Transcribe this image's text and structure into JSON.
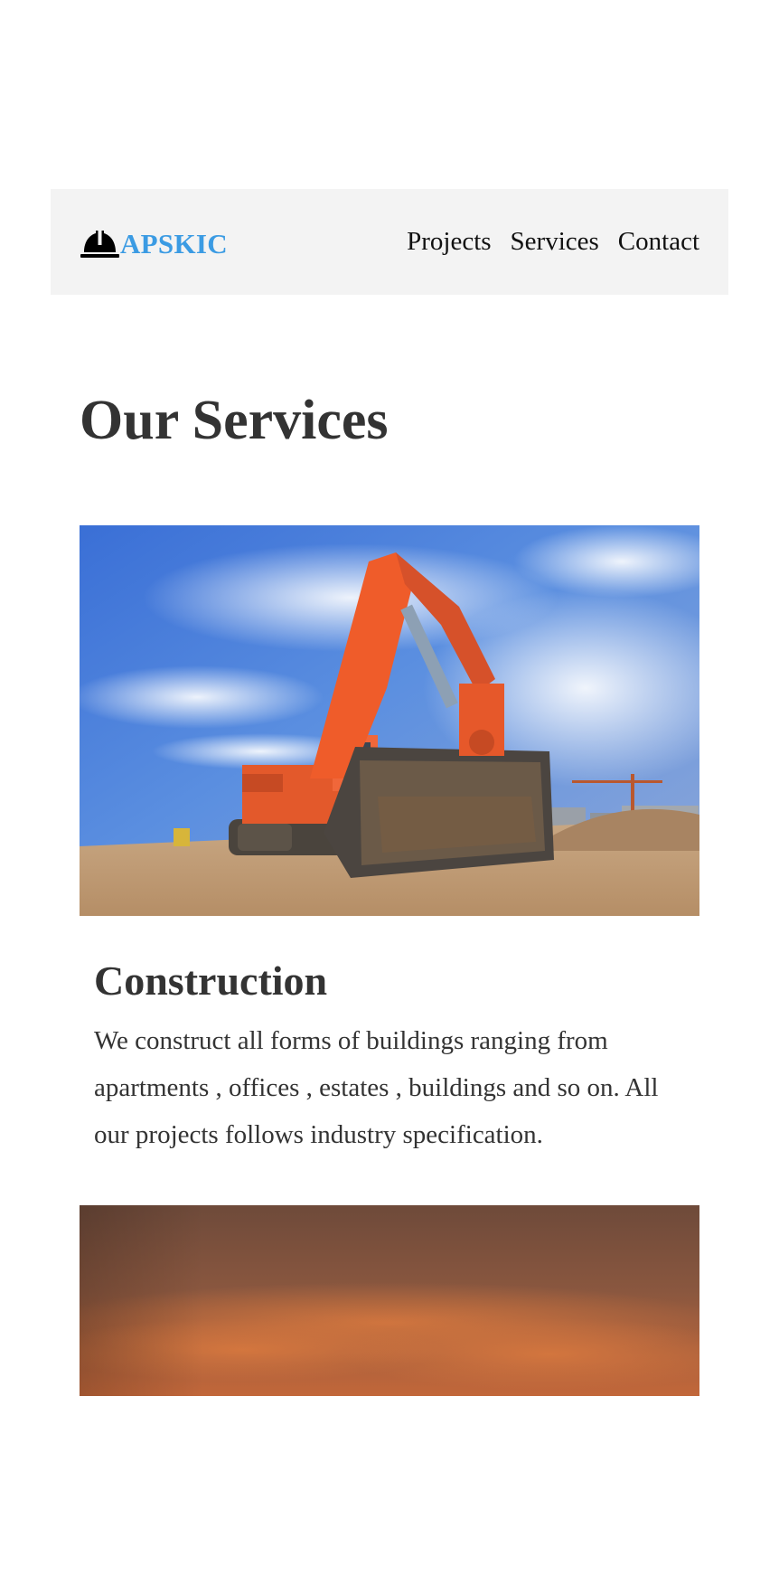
{
  "brand": {
    "name": "APSKIC",
    "icon": "hard-hat-icon",
    "color": "#3b9be3"
  },
  "nav": {
    "items": [
      {
        "label": "Projects"
      },
      {
        "label": "Services"
      },
      {
        "label": "Contact"
      }
    ]
  },
  "page": {
    "title": "Our Services"
  },
  "services": [
    {
      "image": "excavator-construction-site-photo",
      "title": "Construction",
      "description": "We construct all forms of buildings ranging from apartments , offices , estates , buildings and so on. All our projects follows industry specification."
    },
    {
      "image": "orange-sunset-sky-photo"
    }
  ],
  "colors": {
    "navbar_background": "#f3f3f3",
    "text": "#333333",
    "nav_text": "#111111"
  }
}
